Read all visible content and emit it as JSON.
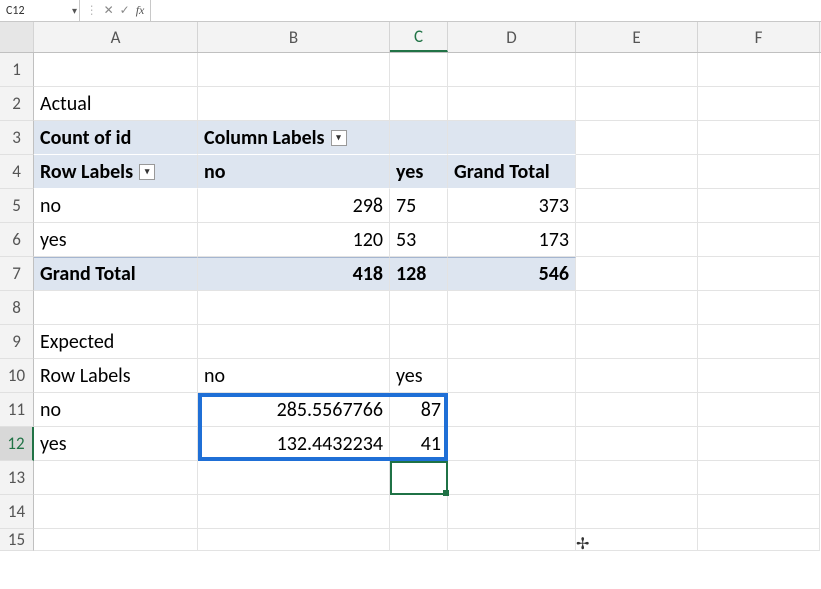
{
  "formula_bar": {
    "name_box": "C12",
    "cancel": "✕",
    "confirm": "✓",
    "fx": "fx",
    "formula": ""
  },
  "columns": [
    "",
    "A",
    "B",
    "C",
    "D",
    "E",
    "F"
  ],
  "row_numbers": [
    "1",
    "2",
    "3",
    "4",
    "5",
    "6",
    "7",
    "8",
    "9",
    "10",
    "11",
    "12",
    "13",
    "14",
    "15"
  ],
  "cells": {
    "A2": "Actual",
    "A3": "Count of id",
    "B3": "Column Labels",
    "A4": "Row Labels",
    "B4": "no",
    "C4": "yes",
    "D4": "Grand Total",
    "A5": "no",
    "B5": "298",
    "C5": "75",
    "D5": "373",
    "A6": "yes",
    "B6": "120",
    "C6": "53",
    "D6": "173",
    "A7": "Grand Total",
    "B7": "418",
    "C7": "128",
    "D7": "546",
    "A9": "Expected",
    "A10": "Row Labels",
    "B10": "no",
    "C10": "yes",
    "A11": "no",
    "B11": "285.5567766",
    "C11": "87",
    "A12": "yes",
    "B12": "132.4432234",
    "C12": "41"
  },
  "active_cell": "C12",
  "selection_display_cell": "C13",
  "highlight_range": "B11:C12"
}
